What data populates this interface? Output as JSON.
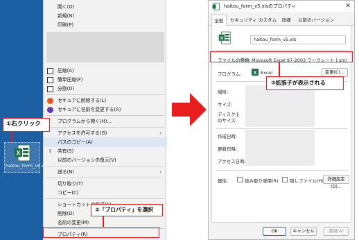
{
  "desktop": {
    "file_name": "haitou_form_v5.xls"
  },
  "context_menu": {
    "items": [
      {
        "label": "開く(O)"
      },
      {
        "label": "新規(N)"
      },
      {
        "label": "印刷(P)"
      },
      {
        "label": "圧縮(A)"
      },
      {
        "label": "簡単圧縮(F)"
      },
      {
        "label": "分割(D)"
      },
      {
        "label": "セキュアに削除する(L)"
      },
      {
        "label": "セキュアに名前を変更する(A)"
      },
      {
        "label": "プログラムから開く(H)..."
      },
      {
        "label": "アクセスを許可する(G)"
      },
      {
        "label": "パスのコピー(A)"
      },
      {
        "label": "共有(S)"
      },
      {
        "label": "以前のバージョンの復元(V)"
      },
      {
        "label": "送る(N)"
      },
      {
        "label": "切り取り(T)"
      },
      {
        "label": "コピー(C)"
      },
      {
        "label": "ショートカットの作成(S)"
      },
      {
        "label": "削除(D)"
      },
      {
        "label": "名前の変更(M)"
      },
      {
        "label": "プロパティ(R)"
      }
    ]
  },
  "callouts": {
    "step1": "①右クリック",
    "step2": "②「プロパティ」を選択",
    "step3": "③拡張子が表示される"
  },
  "dialog": {
    "title": "haitou_form_v5.xlsのプロパティ",
    "close_glyph": "✕",
    "tabs": [
      "全般",
      "セキュリティ",
      "カスタム",
      "詳細",
      "以前のバージョン"
    ],
    "file_name": "haitou_form_v5.xls",
    "file_type_label": "ファイルの種類:",
    "file_type_value": "Microsoft Excel 97-2003 ワークシート (.xls)",
    "program_label": "プログラム:",
    "program_value": "Excel",
    "change_button": "変更(C)...",
    "location_label": "場所:",
    "size_label": "サイズ:",
    "disk_size_label": "ディスク上\nのサイズ:",
    "created_label": "作成日時:",
    "modified_label": "更新日時:",
    "accessed_label": "アクセス日時:",
    "attributes_label": "属性:",
    "readonly_label": "読み取り専用(R)",
    "hidden_label": "隠しファイル(H)",
    "advanced_button": "詳細設定(D)...",
    "ok_button": "OK",
    "cancel_button": "キャンセル",
    "apply_button": "適用(A)"
  },
  "colors": {
    "accent_red": "#e81e1e",
    "excel_green": "#1d7044",
    "desktop_blue": "#1d5fa3"
  }
}
